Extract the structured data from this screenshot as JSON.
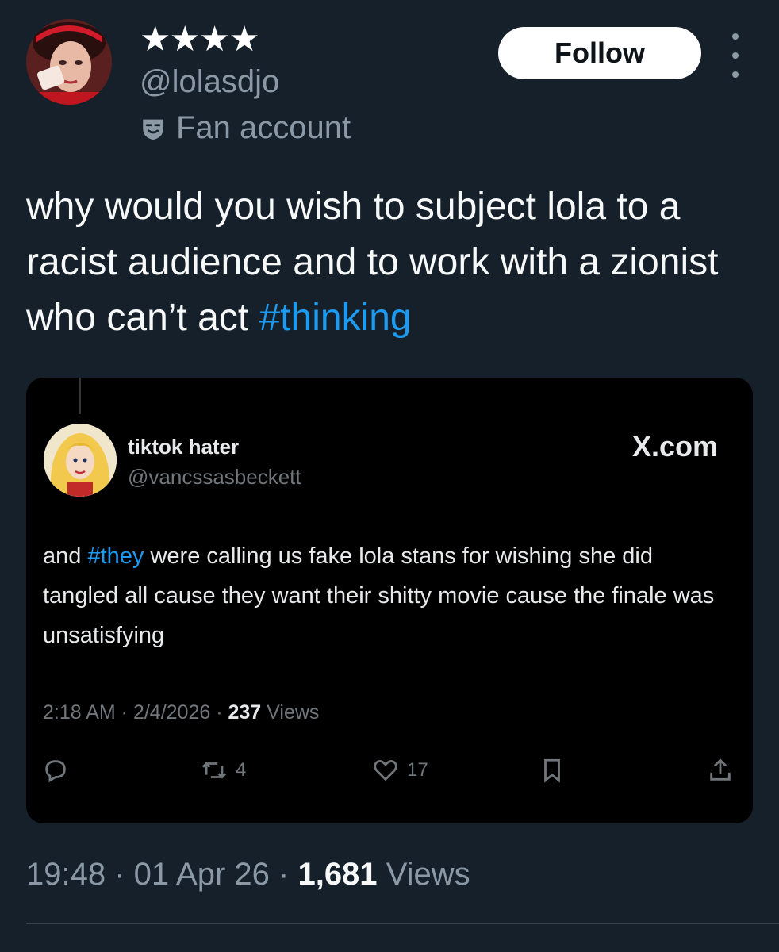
{
  "author": {
    "stars": "★★★★",
    "handle": "@lolasdjo",
    "badge_label": "Fan account",
    "avatar_icon": "profile-photo",
    "badge_icon": "mask-icon"
  },
  "follow_label": "Follow",
  "tweet": {
    "text_before": "why would you wish to subject lola to a racist audience and to work with a zionist who can’t act ",
    "hashtag": "#thinking"
  },
  "quote": {
    "name": "tiktok hater",
    "handle": "@vancssasbeckett",
    "brand": "X.com",
    "text_before": "and ",
    "hashtag": "#they",
    "text_after": " were calling us fake lola stans for wishing she did tangled all cause they want their shitty movie cause the finale was unsatisfying",
    "time": "2:18 AM",
    "date": "2/4/2026",
    "views_count": "237",
    "views_label": "Views",
    "retweets": "4",
    "likes": "17"
  },
  "meta": {
    "time": "19:48",
    "date": "01 Apr 26",
    "views_count": "1,681",
    "views_label": "Views"
  },
  "colors": {
    "background": "#15202b",
    "hashtag": "#1d9bf0",
    "muted": "#8b98a5"
  }
}
